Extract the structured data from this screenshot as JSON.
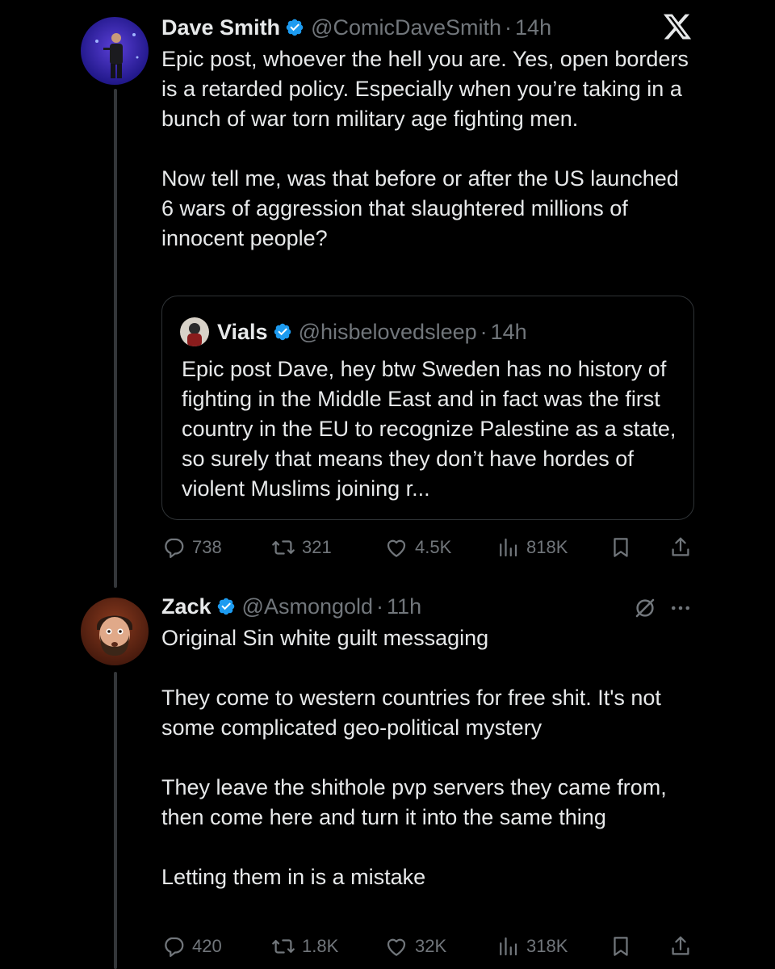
{
  "posts": [
    {
      "author_name": "Dave Smith",
      "handle": "@ComicDaveSmith",
      "separator": "·",
      "time": "14h",
      "text_paragraphs": [
        "Epic post, whoever the hell you are. Yes, open borders is a retarded policy. Especially when you’re taking in a bunch of war torn military age fighting men.",
        "Now tell me, was that before or after the US launched 6 wars of aggression that slaughtered millions of innocent people?"
      ],
      "quote": {
        "author_name": "Vials",
        "handle": "@hisbelovedsleep",
        "separator": "·",
        "time": "14h",
        "text": "Epic post Dave, hey btw Sweden has no history of fighting in the Middle East and in fact was the first country in the EU to recognize Palestine as a state, so surely that means they don’t have hordes of violent Muslims joining r..."
      },
      "stats": {
        "replies": "738",
        "reposts": "321",
        "likes": "4.5K",
        "views": "818K"
      }
    },
    {
      "author_name": "Zack",
      "handle": "@Asmongold",
      "separator": "·",
      "time": "11h",
      "text_paragraphs": [
        "Original Sin white guilt messaging",
        "They come to western countries for free shit. It's not some complicated geo-political mystery",
        "They leave the shithole pvp servers they came from, then come here and turn it into the same thing",
        "Letting them in is a mistake"
      ],
      "stats": {
        "replies": "420",
        "reposts": "1.8K",
        "likes": "32K",
        "views": "318K"
      }
    }
  ],
  "icons": {
    "brand": "x-logo-icon",
    "verified": "verified-badge-icon",
    "reply": "reply-icon",
    "repost": "repost-icon",
    "like": "heart-icon",
    "views": "views-icon",
    "bookmark": "bookmark-icon",
    "share": "share-icon",
    "mute": "mute-icon",
    "more": "more-icon"
  },
  "colors": {
    "background": "#000000",
    "text": "#e7e9ea",
    "secondary": "#71767b",
    "verified": "#1d9bf0",
    "border": "#2f3336"
  }
}
